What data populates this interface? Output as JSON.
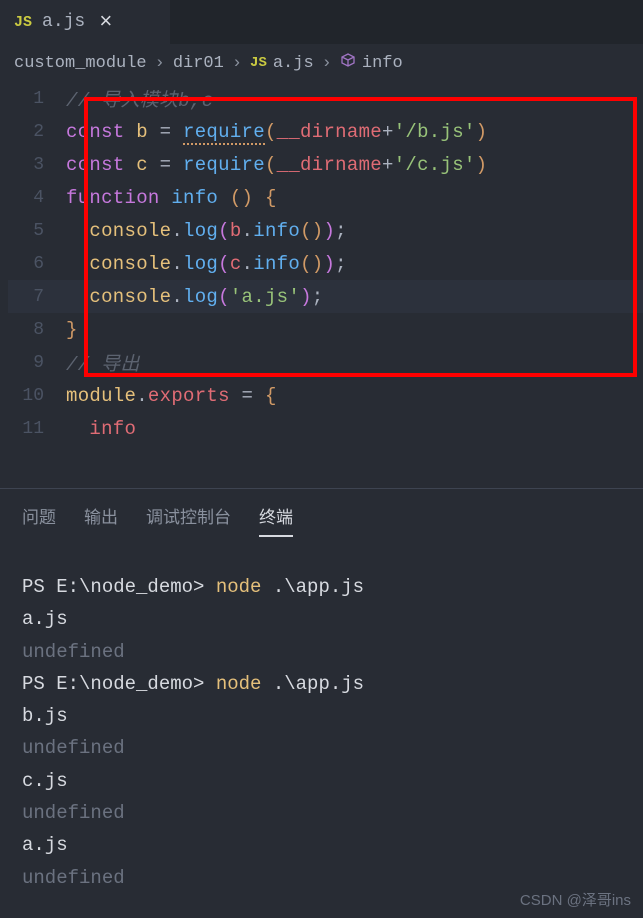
{
  "tab": {
    "icon": "JS",
    "label": "a.js",
    "close": "×"
  },
  "breadcrumb": {
    "items": [
      {
        "label": "custom_module"
      },
      {
        "label": "dir01"
      },
      {
        "icon": "JS",
        "label": "a.js"
      },
      {
        "icon": "cube",
        "label": "info"
      }
    ],
    "sep": "›"
  },
  "code": {
    "lines": [
      {
        "n": "1",
        "tokens": [
          {
            "t": "// 导入模块b,c",
            "c": "cm"
          }
        ]
      },
      {
        "n": "2",
        "tokens": [
          {
            "t": "const",
            "c": "kw"
          },
          {
            "t": " ",
            "c": "op"
          },
          {
            "t": "b",
            "c": "varb"
          },
          {
            "t": " ",
            "c": "op"
          },
          {
            "t": "=",
            "c": "op"
          },
          {
            "t": " ",
            "c": "op"
          },
          {
            "t": "require",
            "c": "fn squiggle"
          },
          {
            "t": "(",
            "c": "bracket-y"
          },
          {
            "t": "__dirname",
            "c": "var"
          },
          {
            "t": "+",
            "c": "op"
          },
          {
            "t": "'/b.js'",
            "c": "str"
          },
          {
            "t": ")",
            "c": "bracket-y"
          }
        ]
      },
      {
        "n": "3",
        "tokens": [
          {
            "t": "const",
            "c": "kw"
          },
          {
            "t": " ",
            "c": "op"
          },
          {
            "t": "c",
            "c": "varb"
          },
          {
            "t": " ",
            "c": "op"
          },
          {
            "t": "=",
            "c": "op"
          },
          {
            "t": " ",
            "c": "op"
          },
          {
            "t": "require",
            "c": "fn"
          },
          {
            "t": "(",
            "c": "bracket-y"
          },
          {
            "t": "__dirname",
            "c": "var"
          },
          {
            "t": "+",
            "c": "op"
          },
          {
            "t": "'/c.js'",
            "c": "str"
          },
          {
            "t": ")",
            "c": "bracket-y"
          }
        ]
      },
      {
        "n": "4",
        "tokens": [
          {
            "t": "function",
            "c": "kw"
          },
          {
            "t": " ",
            "c": "op"
          },
          {
            "t": "info",
            "c": "fn"
          },
          {
            "t": " ",
            "c": "op"
          },
          {
            "t": "(",
            "c": "bracket-y"
          },
          {
            "t": ")",
            "c": "bracket-y"
          },
          {
            "t": " ",
            "c": "op"
          },
          {
            "t": "{",
            "c": "bracket-y"
          }
        ]
      },
      {
        "n": "5",
        "tokens": [
          {
            "t": "  ",
            "c": "op"
          },
          {
            "t": "console",
            "c": "varb"
          },
          {
            "t": ".",
            "c": "punc"
          },
          {
            "t": "log",
            "c": "fn"
          },
          {
            "t": "(",
            "c": "bracket-p"
          },
          {
            "t": "b",
            "c": "var"
          },
          {
            "t": ".",
            "c": "punc"
          },
          {
            "t": "info",
            "c": "fn"
          },
          {
            "t": "(",
            "c": "bracket-y"
          },
          {
            "t": ")",
            "c": "bracket-y"
          },
          {
            "t": ")",
            "c": "bracket-p"
          },
          {
            "t": ";",
            "c": "punc"
          }
        ]
      },
      {
        "n": "6",
        "tokens": [
          {
            "t": "  ",
            "c": "op"
          },
          {
            "t": "console",
            "c": "varb"
          },
          {
            "t": ".",
            "c": "punc"
          },
          {
            "t": "log",
            "c": "fn"
          },
          {
            "t": "(",
            "c": "bracket-p"
          },
          {
            "t": "c",
            "c": "var"
          },
          {
            "t": ".",
            "c": "punc"
          },
          {
            "t": "info",
            "c": "fn"
          },
          {
            "t": "(",
            "c": "bracket-y"
          },
          {
            "t": ")",
            "c": "bracket-y"
          },
          {
            "t": ")",
            "c": "bracket-p"
          },
          {
            "t": ";",
            "c": "punc"
          }
        ]
      },
      {
        "n": "7",
        "tokens": [
          {
            "t": "  ",
            "c": "op"
          },
          {
            "t": "console",
            "c": "varb"
          },
          {
            "t": ".",
            "c": "punc"
          },
          {
            "t": "log",
            "c": "fn"
          },
          {
            "t": "(",
            "c": "bracket-p"
          },
          {
            "t": "'a.js'",
            "c": "str"
          },
          {
            "t": ")",
            "c": "bracket-p"
          },
          {
            "t": ";",
            "c": "punc"
          }
        ],
        "hl": true
      },
      {
        "n": "8",
        "tokens": [
          {
            "t": "}",
            "c": "bracket-y"
          }
        ]
      },
      {
        "n": "9",
        "tokens": [
          {
            "t": "// 导出",
            "c": "cm"
          }
        ]
      },
      {
        "n": "10",
        "tokens": [
          {
            "t": "module",
            "c": "varb"
          },
          {
            "t": ".",
            "c": "punc"
          },
          {
            "t": "exports",
            "c": "var"
          },
          {
            "t": " ",
            "c": "op"
          },
          {
            "t": "=",
            "c": "op"
          },
          {
            "t": " ",
            "c": "op"
          },
          {
            "t": "{",
            "c": "bracket-y"
          }
        ]
      },
      {
        "n": "11",
        "tokens": [
          {
            "t": "  ",
            "c": "op"
          },
          {
            "t": "info",
            "c": "var"
          }
        ]
      }
    ]
  },
  "panel": {
    "tabs": [
      "问题",
      "输出",
      "调试控制台",
      "终端"
    ],
    "active": 3
  },
  "terminal": [
    {
      "segs": [
        {
          "t": "PS E:\\node_demo> ",
          "c": "prompt"
        },
        {
          "t": "node",
          "c": "cmd"
        },
        {
          "t": " .\\app.js",
          "c": "arg"
        }
      ]
    },
    {
      "segs": [
        {
          "t": "a.js",
          "c": "out"
        }
      ]
    },
    {
      "segs": [
        {
          "t": "undefined",
          "c": "undef"
        }
      ]
    },
    {
      "segs": [
        {
          "t": "PS E:\\node_demo> ",
          "c": "prompt"
        },
        {
          "t": "node",
          "c": "cmd"
        },
        {
          "t": " .\\app.js",
          "c": "arg"
        }
      ]
    },
    {
      "segs": [
        {
          "t": "b.js",
          "c": "out"
        }
      ]
    },
    {
      "segs": [
        {
          "t": "undefined",
          "c": "undef"
        }
      ]
    },
    {
      "segs": [
        {
          "t": "c.js",
          "c": "out"
        }
      ]
    },
    {
      "segs": [
        {
          "t": "undefined",
          "c": "undef"
        }
      ]
    },
    {
      "segs": [
        {
          "t": "a.js",
          "c": "out"
        }
      ]
    },
    {
      "segs": [
        {
          "t": "undefined",
          "c": "undef"
        }
      ]
    }
  ],
  "watermark": "CSDN @泽哥ins"
}
